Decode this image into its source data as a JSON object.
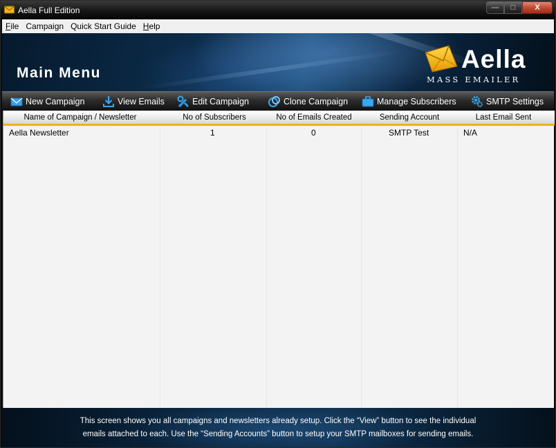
{
  "window": {
    "title": "Aella Full Edition",
    "controls": {
      "minimize": "—",
      "maximize": "□",
      "close": "X"
    }
  },
  "menu": [
    {
      "label": "File",
      "ul": "F",
      "rest": "ile"
    },
    {
      "label": "Campaign",
      "ul": "",
      "rest": "Campaign"
    },
    {
      "label": "Quick Start Guide",
      "ul": "",
      "rest": "Quick Start Guide"
    },
    {
      "label": "Help",
      "ul": "H",
      "rest": "elp"
    }
  ],
  "header": {
    "page_title": "Main Menu",
    "logo_name": "Aella",
    "logo_tagline": "MASS EMAILER"
  },
  "toolbar": {
    "new_campaign": "New Campaign",
    "view_emails": "View Emails",
    "edit_campaign": "Edit Campaign",
    "clone_campaign": "Clone Campaign",
    "manage_subscribers": "Manage Subscribers",
    "smtp_settings": "SMTP Settings"
  },
  "table": {
    "columns": [
      "Name of Campaign / Newsletter",
      "No of Subscribers",
      "No of Emails Created",
      "Sending Account",
      "Last Email Sent"
    ],
    "rows": [
      {
        "name": "Aella Newsletter",
        "subscribers": "1",
        "emails_created": "0",
        "sending_account": "SMTP Test",
        "last_sent": "N/A"
      }
    ]
  },
  "footer": {
    "line1": "This screen shows you all campaigns and newsletters already setup.  Click the “View” button to see the individual",
    "line2": "emails attached to each.  Use the “Sending Accounts” button to setup your SMTP mailboxes for sending emails."
  },
  "colors": {
    "accent_yellow": "#f0b400",
    "banner_blue": "#0c2c4a",
    "toolbar_dark": "#1a1a1a"
  }
}
